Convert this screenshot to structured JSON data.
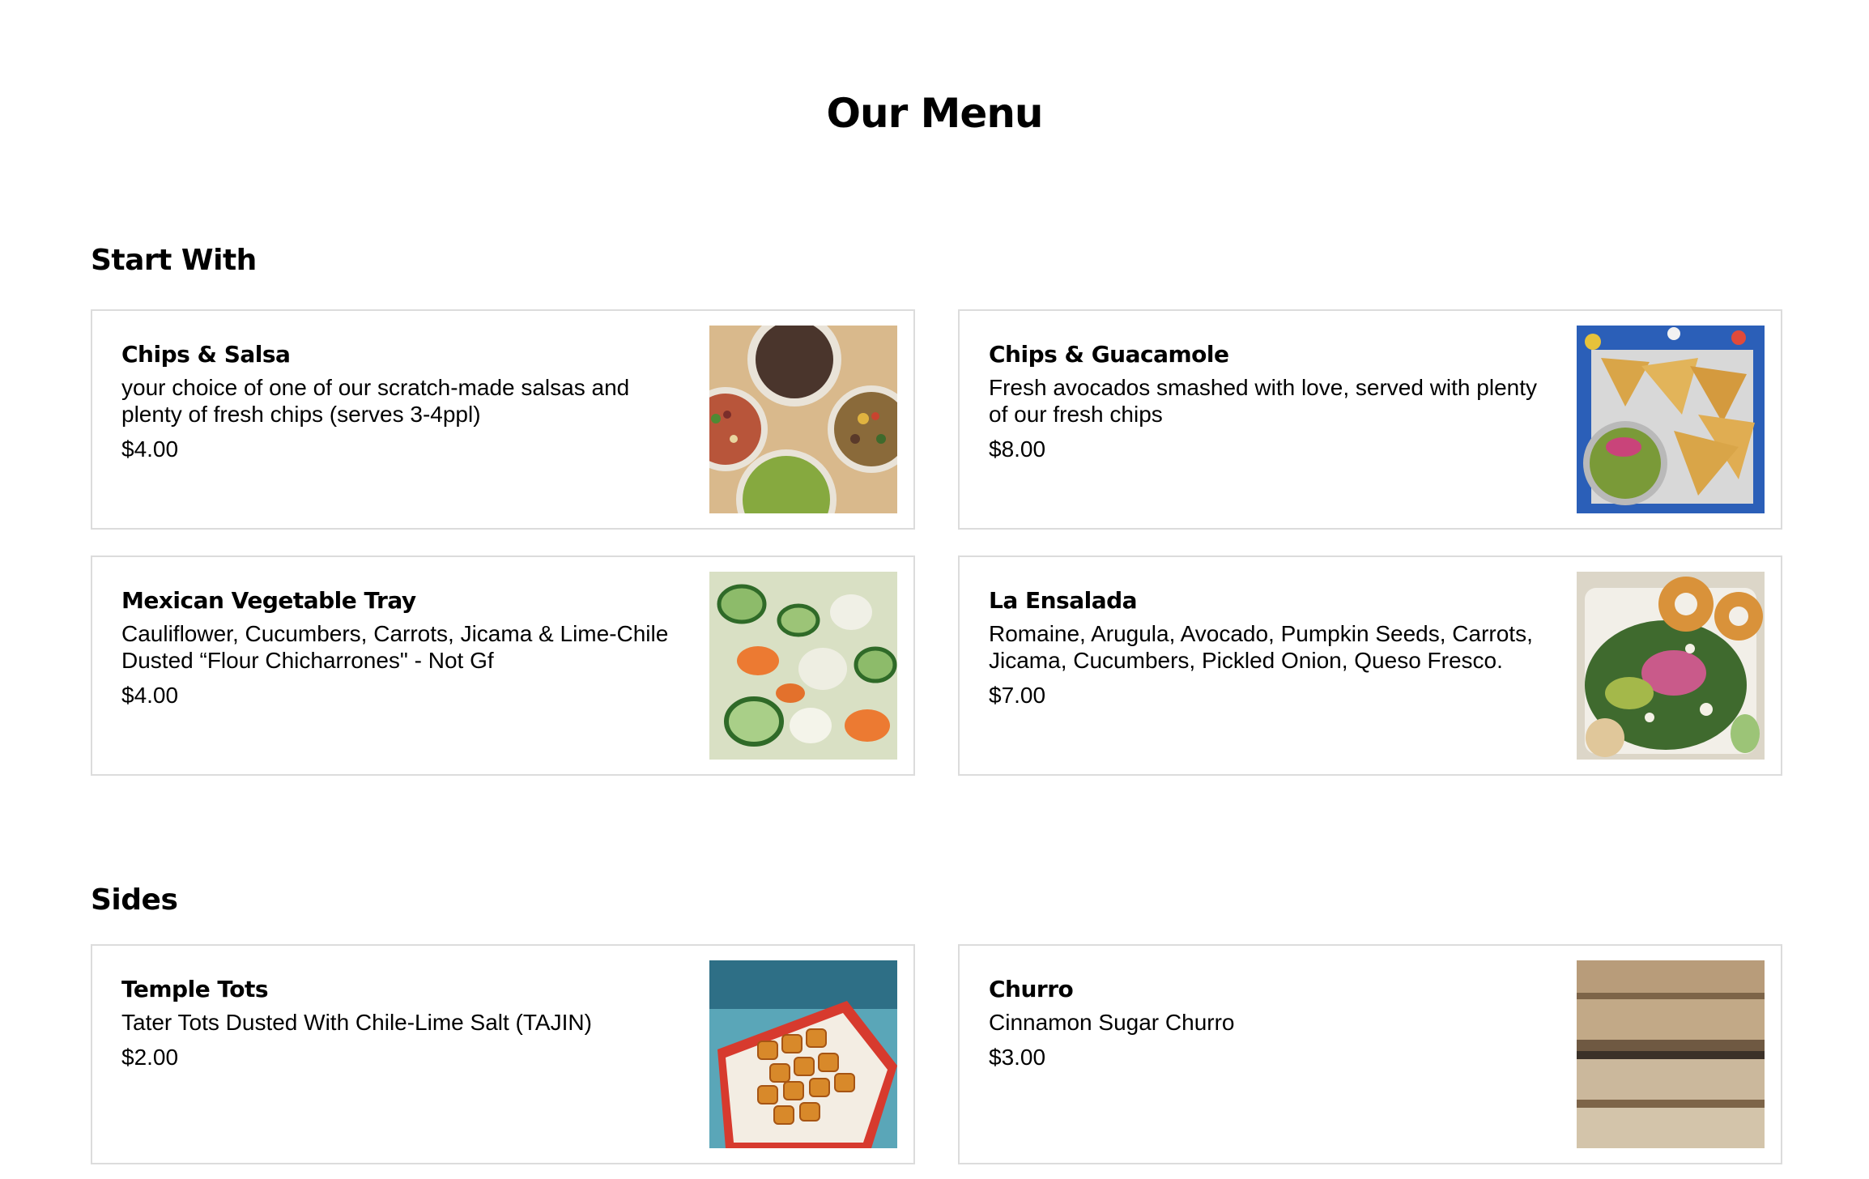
{
  "page": {
    "title": "Our Menu"
  },
  "sections": [
    {
      "title": "Start With",
      "items": [
        {
          "name": "Chips & Salsa",
          "description": "your choice of one of our scratch-made salsas and plenty of fresh chips (serves 3-4ppl)",
          "price": "$4.00",
          "image": "salsa-bowls-photo"
        },
        {
          "name": "Chips & Guacamole",
          "description": "Fresh avocados smashed with love, served with plenty of our fresh chips",
          "price": "$8.00",
          "image": "chips-guacamole-photo"
        },
        {
          "name": "Mexican Vegetable Tray",
          "description": "Cauliflower, Cucumbers, Carrots, Jicama & Lime-Chile Dusted “Flour Chicharrones\" - Not Gf",
          "price": "$4.00",
          "image": "vegetable-tray-photo"
        },
        {
          "name": "La Ensalada",
          "description": "Romaine, Arugula, Avocado, Pumpkin Seeds, Carrots, Jicama, Cucumbers, Pickled Onion, Queso Fresco.",
          "price": "$7.00",
          "image": "salad-photo"
        }
      ]
    },
    {
      "title": "Sides",
      "items": [
        {
          "name": "Temple Tots",
          "description": "Tater Tots Dusted With Chile-Lime Salt (TAJIN)",
          "price": "$2.00",
          "image": "tater-tots-photo"
        },
        {
          "name": "Churro",
          "description": "Cinnamon Sugar Churro",
          "price": "$3.00",
          "image": "churro-photo"
        }
      ]
    }
  ]
}
